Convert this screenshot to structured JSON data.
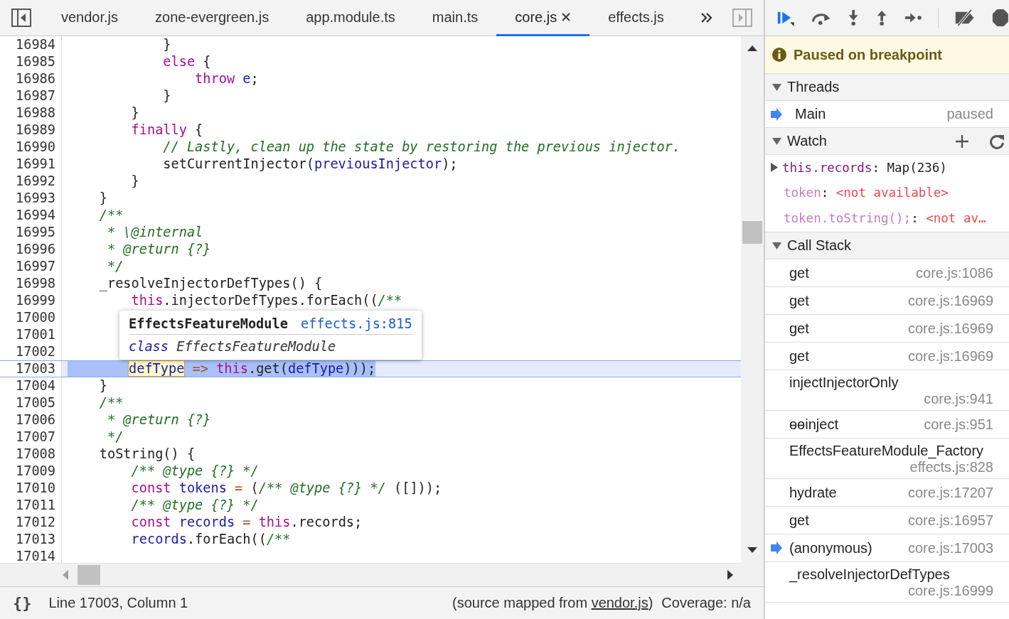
{
  "editor_tabs": [
    {
      "label": "vendor.js",
      "selected": false,
      "closable": false
    },
    {
      "label": "zone-evergreen.js",
      "selected": false,
      "closable": false
    },
    {
      "label": "app.module.ts",
      "selected": false,
      "closable": false
    },
    {
      "label": "main.ts",
      "selected": false,
      "closable": false
    },
    {
      "label": "core.js",
      "selected": true,
      "closable": true
    },
    {
      "label": "effects.js",
      "selected": false,
      "closable": false
    }
  ],
  "code_lines": [
    {
      "number": "16984",
      "paused": false,
      "tokens": [
        {
          "kind": "plain",
          "text": "            }"
        }
      ]
    },
    {
      "number": "16985",
      "paused": false,
      "tokens": [
        {
          "kind": "keyword",
          "text": "            else"
        },
        {
          "kind": "plain",
          "text": " {"
        }
      ]
    },
    {
      "number": "16986",
      "paused": false,
      "tokens": [
        {
          "kind": "keyword",
          "text": "                throw"
        },
        {
          "kind": "variable",
          "text": " e"
        },
        {
          "kind": "plain",
          "text": ";"
        }
      ]
    },
    {
      "number": "16987",
      "paused": false,
      "tokens": [
        {
          "kind": "plain",
          "text": "            }"
        }
      ]
    },
    {
      "number": "16988",
      "paused": false,
      "tokens": [
        {
          "kind": "plain",
          "text": "        }"
        }
      ]
    },
    {
      "number": "16989",
      "paused": false,
      "tokens": [
        {
          "kind": "keyword",
          "text": "        finally"
        },
        {
          "kind": "plain",
          "text": " {"
        }
      ]
    },
    {
      "number": "16990",
      "paused": false,
      "tokens": [
        {
          "kind": "comment",
          "text": "            // Lastly, clean up the state by restoring the previous injector."
        }
      ]
    },
    {
      "number": "16991",
      "paused": false,
      "tokens": [
        {
          "kind": "plain",
          "text": "            setCurrentInjector("
        },
        {
          "kind": "variable",
          "text": "previousInjector"
        },
        {
          "kind": "plain",
          "text": ");"
        }
      ]
    },
    {
      "number": "16992",
      "paused": false,
      "tokens": [
        {
          "kind": "plain",
          "text": "        }"
        }
      ]
    },
    {
      "number": "16993",
      "paused": false,
      "tokens": [
        {
          "kind": "plain",
          "text": "    }"
        }
      ]
    },
    {
      "number": "16994",
      "paused": false,
      "tokens": [
        {
          "kind": "comment",
          "text": "    /**"
        }
      ]
    },
    {
      "number": "16995",
      "paused": false,
      "tokens": [
        {
          "kind": "comment",
          "text": "     * \\@internal"
        }
      ]
    },
    {
      "number": "16996",
      "paused": false,
      "tokens": [
        {
          "kind": "comment",
          "text": "     * @return {?}"
        }
      ]
    },
    {
      "number": "16997",
      "paused": false,
      "tokens": [
        {
          "kind": "comment",
          "text": "     */"
        }
      ]
    },
    {
      "number": "16998",
      "paused": false,
      "tokens": [
        {
          "kind": "plain",
          "text": "    _resolveInjectorDefTypes() {"
        }
      ]
    },
    {
      "number": "16999",
      "paused": false,
      "tokens": [
        {
          "kind": "keyword",
          "text": "        this"
        },
        {
          "kind": "plain",
          "text": ".injectorDefTypes.forEach(("
        },
        {
          "kind": "comment",
          "text": "/**"
        }
      ]
    },
    {
      "number": "17000",
      "paused": false
    },
    {
      "number": "17001",
      "paused": false
    },
    {
      "number": "17002",
      "paused": false
    },
    {
      "number": "17003",
      "paused": true,
      "tokens": [
        {
          "kind": "hover",
          "text": "defType"
        },
        {
          "kind": "operator",
          "text": " =>"
        },
        {
          "kind": "keyword",
          "text": " this"
        },
        {
          "kind": "plain",
          "text": ".get("
        },
        {
          "kind": "variable",
          "text": "defType"
        },
        {
          "kind": "plain",
          "text": ")));"
        }
      ]
    },
    {
      "number": "17004",
      "paused": false,
      "tokens": [
        {
          "kind": "plain",
          "text": "    }"
        }
      ]
    },
    {
      "number": "17005",
      "paused": false,
      "tokens": [
        {
          "kind": "comment",
          "text": "    /**"
        }
      ]
    },
    {
      "number": "17006",
      "paused": false,
      "tokens": [
        {
          "kind": "comment",
          "text": "     * @return {?}"
        }
      ]
    },
    {
      "number": "17007",
      "paused": false,
      "tokens": [
        {
          "kind": "comment",
          "text": "     */"
        }
      ]
    },
    {
      "number": "17008",
      "paused": false,
      "tokens": [
        {
          "kind": "plain",
          "text": "    toString() {"
        }
      ]
    },
    {
      "number": "17009",
      "paused": false,
      "tokens": [
        {
          "kind": "comment",
          "text": "        /** @type {?} */"
        }
      ]
    },
    {
      "number": "17010",
      "paused": false,
      "tokens": [
        {
          "kind": "keyword",
          "text": "        const"
        },
        {
          "kind": "variable",
          "text": " tokens"
        },
        {
          "kind": "operator",
          "text": " ="
        },
        {
          "kind": "plain",
          "text": " ("
        },
        {
          "kind": "comment",
          "text": "/** @type {?} */"
        },
        {
          "kind": "plain",
          "text": " ([]));"
        }
      ]
    },
    {
      "number": "17011",
      "paused": false,
      "tokens": [
        {
          "kind": "comment",
          "text": "        /** @type {?} */"
        }
      ]
    },
    {
      "number": "17012",
      "paused": false,
      "tokens": [
        {
          "kind": "keyword",
          "text": "        const"
        },
        {
          "kind": "variable",
          "text": " records"
        },
        {
          "kind": "operator",
          "text": " ="
        },
        {
          "kind": "keyword",
          "text": " this"
        },
        {
          "kind": "plain",
          "text": ".records;"
        }
      ]
    },
    {
      "number": "17013",
      "paused": false,
      "tokens": [
        {
          "kind": "variable",
          "text": "        records"
        },
        {
          "kind": "plain",
          "text": ".forEach(("
        },
        {
          "kind": "comment",
          "text": "/**"
        }
      ]
    },
    {
      "number": "17014",
      "paused": false
    }
  ],
  "tooltip": {
    "title": "EffectsFeatureModule",
    "link": "effects.js:815",
    "keyword": "class",
    "name": "EffectsFeatureModule"
  },
  "status_bar": {
    "format_label": "{}",
    "position": "Line 17003, Column 1",
    "source_prefix": "(source mapped from ",
    "source_link": "vendor.js",
    "source_suffix": ")",
    "coverage": "Coverage: n/a"
  },
  "banner": "Paused on breakpoint",
  "threads": {
    "title": "Threads",
    "expanded": true,
    "items": [
      {
        "name": "Main",
        "status": "paused",
        "selected": true
      }
    ]
  },
  "watch": {
    "title": "Watch",
    "expanded": true,
    "items": [
      {
        "name": "this.records",
        "separator": ":",
        "value": "Map(236)",
        "kind": "object"
      },
      {
        "name": "token",
        "separator": ":",
        "value": "<not available>",
        "kind": "error"
      },
      {
        "name": "token.toString();",
        "separator": ":",
        "value": "<not av…",
        "kind": "error"
      }
    ]
  },
  "call_stack": {
    "title": "Call Stack",
    "expanded": true,
    "frames": [
      {
        "name": "get",
        "location": "core.js:1086",
        "kind": "inline",
        "selected": false
      },
      {
        "name": "get",
        "location": "core.js:16969",
        "kind": "inline",
        "selected": false
      },
      {
        "name": "get",
        "location": "core.js:16969",
        "kind": "inline",
        "selected": false
      },
      {
        "name": "get",
        "location": "core.js:16969",
        "kind": "inline",
        "selected": false
      },
      {
        "name": "injectInjectorOnly",
        "location": "core.js:941",
        "kind": "wrapped",
        "selected": false
      },
      {
        "name": "ɵɵinject",
        "location": "core.js:951",
        "kind": "inline",
        "selected": false
      },
      {
        "name": "EffectsFeatureModule_Factory",
        "location": "effects.js:828",
        "kind": "wrapped",
        "selected": false
      },
      {
        "name": "hydrate",
        "location": "core.js:17207",
        "kind": "inline",
        "selected": false
      },
      {
        "name": "get",
        "location": "core.js:16957",
        "kind": "inline",
        "selected": false
      },
      {
        "name": "(anonymous)",
        "location": "core.js:17003",
        "kind": "inline",
        "selected": true
      },
      {
        "name": "_resolveInjectorDefTypes",
        "location": "core.js:16999",
        "kind": "wrapped",
        "selected": false
      }
    ]
  }
}
